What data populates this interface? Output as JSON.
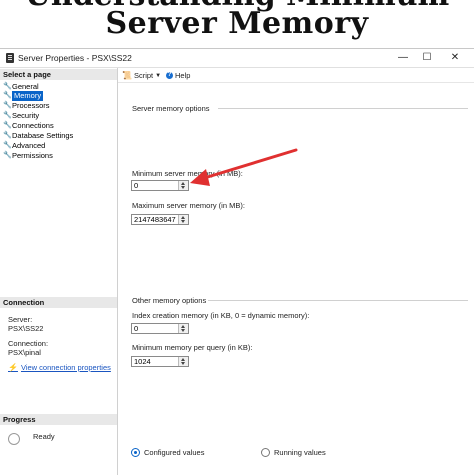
{
  "banner": {
    "title": "Server Memory"
  },
  "window": {
    "title": "Server Properties - PSX\\SS22",
    "controls": {
      "minimize": "—",
      "maximize": "☐",
      "close": "✕"
    }
  },
  "sidebar": {
    "select_page_header": "Select a page",
    "pages": [
      {
        "label": "General",
        "selected": false
      },
      {
        "label": "Memory",
        "selected": true
      },
      {
        "label": "Processors",
        "selected": false
      },
      {
        "label": "Security",
        "selected": false
      },
      {
        "label": "Connections",
        "selected": false
      },
      {
        "label": "Database Settings",
        "selected": false
      },
      {
        "label": "Advanced",
        "selected": false
      },
      {
        "label": "Permissions",
        "selected": false
      }
    ],
    "connection_header": "Connection",
    "server_label": "Server:",
    "server_value": "PSX\\SS22",
    "connection_label": "Connection:",
    "connection_value": "PSX\\pinal",
    "view_link": "View connection properties",
    "progress_header": "Progress",
    "progress_status": "Ready"
  },
  "toolbar": {
    "script_label": "Script",
    "help_label": "Help"
  },
  "main": {
    "server_memory_group": "Server memory options",
    "min_server_memory_label": "Minimum server memory (in MB):",
    "min_server_memory_value": "0",
    "max_server_memory_label": "Maximum server memory (in MB):",
    "max_server_memory_value": "2147483647",
    "other_memory_group": "Other memory options",
    "index_memory_label": "Index creation memory (in KB, 0 = dynamic memory):",
    "index_memory_value": "0",
    "min_query_memory_label": "Minimum memory per query (in KB):",
    "min_query_memory_value": "1024",
    "configured_values_label": "Configured values",
    "running_values_label": "Running values",
    "selected_view": "Configured values"
  },
  "colors": {
    "accent": "#0a64c8",
    "arrow": "#e03030",
    "link": "#1a55c0"
  }
}
